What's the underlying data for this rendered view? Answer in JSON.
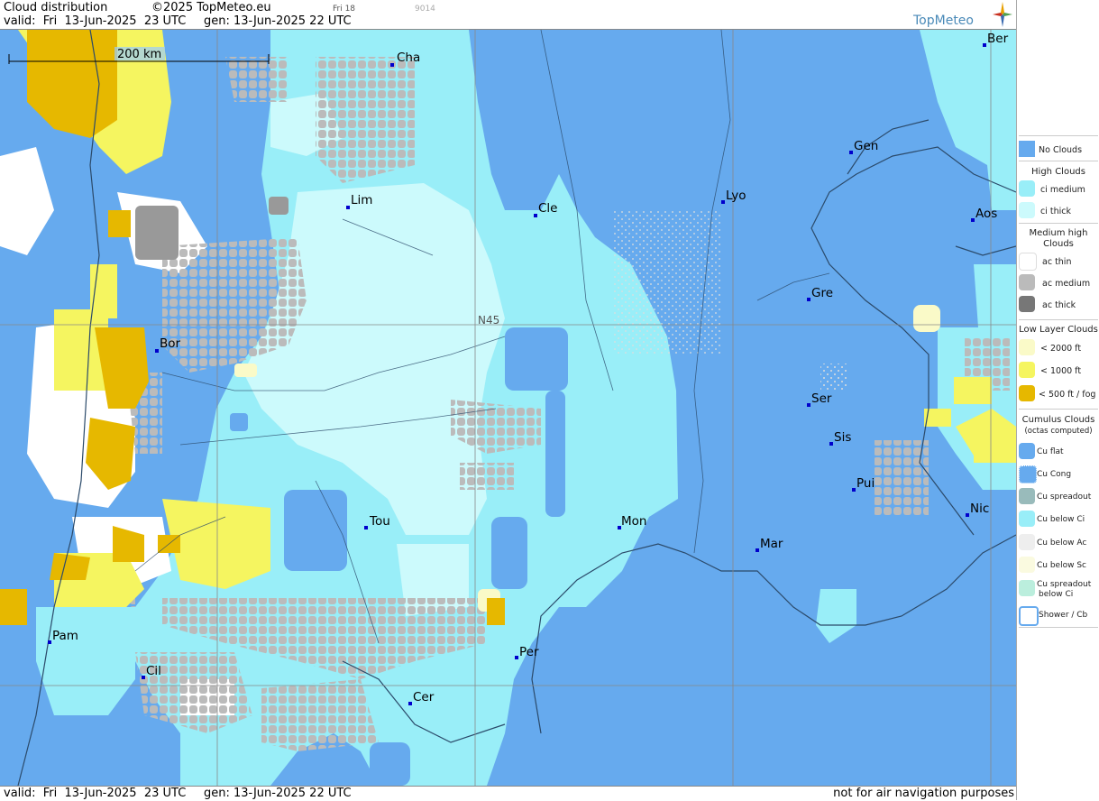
{
  "header": {
    "title": "Cloud distribution",
    "copyright": "©2025 TopMeteo.eu",
    "valid_line": "valid:  Fri  13-Jun-2025  23 UTC",
    "gen_line": "gen: 13-Jun-2025 22 UTC",
    "day_tag": "Fri 18",
    "code_tag": "9014",
    "logo_text": "TopMeteo"
  },
  "map": {
    "scale_label": "200 km",
    "lat_label": "N45",
    "cities": [
      "Cha",
      "Lim",
      "Cle",
      "Lyo",
      "Gen",
      "Ber",
      "Aos",
      "Gre",
      "Bor",
      "Ser",
      "Sis",
      "Pui",
      "Tou",
      "Mon",
      "Mar",
      "Nic",
      "Pam",
      "Cil",
      "Per",
      "Cer"
    ]
  },
  "footer": {
    "valid_line": "valid:  Fri  13-Jun-2025  23 UTC",
    "gen_line": "gen: 13-Jun-2025 22 UTC",
    "disclaimer": "not for air navigation purposes"
  },
  "legend": {
    "no_clouds": "No Clouds",
    "high_title": "High Clouds",
    "ci_medium": "ci medium",
    "ci_thick": "ci thick",
    "medium_title_1": "Medium high",
    "medium_title_2": "Clouds",
    "ac_thin": "ac thin",
    "ac_medium": "ac medium",
    "ac_thick": "ac thick",
    "low_title": "Low Layer Clouds",
    "low_2000": "< 2000 ft",
    "low_1000": "< 1000 ft",
    "low_500": "< 500 ft / fog",
    "cu_title": "Cumulus Clouds",
    "cu_sub": "(octas computed)",
    "cu_flat": "Cu flat",
    "cu_cong": "Cu Cong",
    "cu_spreadout": "Cu spreadout",
    "cu_below_ci": "Cu below Ci",
    "cu_below_ac": "Cu below Ac",
    "cu_below_sc": "Cu below Sc",
    "cu_spread_ci_1": "Cu spreadout",
    "cu_spread_ci_2": "below Ci",
    "shower": "Shower / Cb"
  },
  "colors": {
    "no_clouds": "#66aaee",
    "ci_medium": "#99eef8",
    "ci_thick": "#ccfafc",
    "ac_thin": "#ffffff",
    "ac_medium": "#bbbbbb",
    "ac_thick": "#999999",
    "low_2000": "#fafac8",
    "low_1000": "#f5f560",
    "low_500": "#e6b800",
    "lines": "#2b4a6a"
  }
}
